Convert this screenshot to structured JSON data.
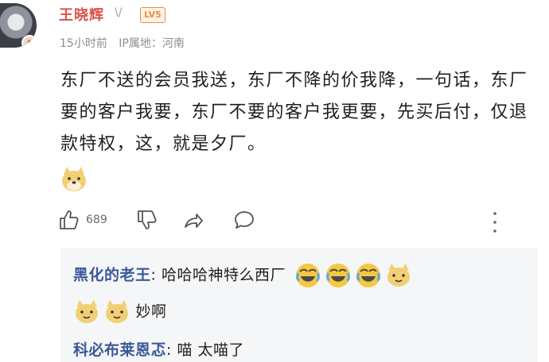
{
  "post": {
    "username": "王晓辉",
    "gender_icon": "gender-icon",
    "level": "LV5",
    "time": "15小时前",
    "ip_location": "IP属地：河南",
    "content": "东厂不送的会员我送，东厂不降的价我降，一句话，东厂要的客户我要，东厂不要的客户我更要，先买后付，仅退款特权，这，就是夕厂。",
    "like_count": "689"
  },
  "replies": [
    {
      "author": "黑化的老王",
      "text": "哈哈哈神特么西厂"
    },
    {
      "author": "",
      "text": "妙啊"
    },
    {
      "author": "科必布莱恩忑",
      "text": "喵 太喵了"
    }
  ],
  "colors": {
    "username": "#d9534a",
    "level_badge": "#e8903c",
    "reply_author": "#3b5998",
    "reply_bg": "#f5f6f7"
  }
}
